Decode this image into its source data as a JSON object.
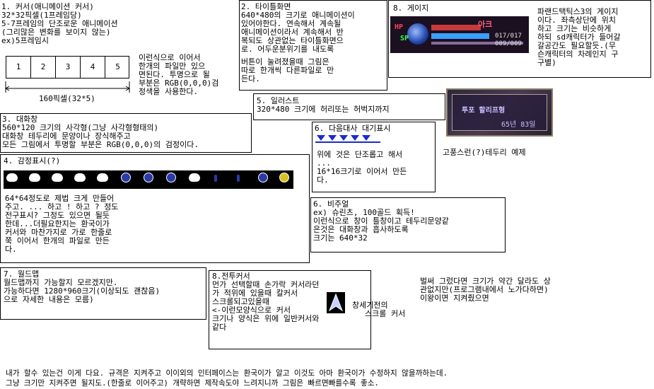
{
  "sec1": {
    "lines": [
      "1. 커서(애니메이션 커서)",
      "32*32픽셀(1프레임당)",
      "5-7프레임의 단조로운 애니메이션",
      "(그리많은 변화를 보이지 않는)",
      "ex)5프레임시"
    ],
    "cells": [
      "1",
      "2",
      "3",
      "4",
      "5"
    ],
    "dim_label": "160픽셀(32*5)",
    "desc": [
      "이런식으로 이어서",
      "한개의 파일만 있으",
      "면된다. 투명으로 될",
      "부분은 RGB(0,0,0)검",
      "정색을 사용한다."
    ]
  },
  "sec2": {
    "lines": [
      "2. 타이틀화면",
      "640*480의 크기로 애니메이션이",
      "있어야한다. 연속해서 계속될",
      "애니메이션이라서 계속해서 반",
      "복되도 상관없는 타이틀화면으",
      "로. 어두운분위기를 내도록",
      "버튼이 눌려졌을때 그림은",
      "따로 한개씩 다른파일로 만",
      "든다."
    ]
  },
  "sec8g": {
    "title": "8. 게이지",
    "gauge": {
      "name": "아크",
      "hp_label": "HP",
      "sp_label": "SP",
      "hp_value": "017/017",
      "sp_value": "009/009"
    },
    "desc": [
      "파랜드택틱스3의 게이지",
      "이다. 좌측상단에 위치",
      "하고 크기는 비슷하게",
      "하되 sd캐릭터가 들어갈",
      "갈공간도 필요할듯.(무",
      "슨캐릭터의 차례인지 구",
      "구별)"
    ]
  },
  "sec5": {
    "lines": [
      "5. 일러스트",
      "320*480 크기에 허리또는 허벅지까지"
    ]
  },
  "frame": {
    "name": "투포 할리프형",
    "stats": "65년 83일",
    "caption": "고풍스런(?)테두리 예제"
  },
  "sec3": {
    "lines": [
      "3. 대화창",
      "560*120 크기의 사각형(그냥 사각형형태의)",
      "대화창 테두리에 문양이나 장식해주고",
      "모든 그림에서 투명할 부분은 RGB(0,0,0)의 검정이다."
    ]
  },
  "sec6a": {
    "lines": [
      "6. 다음대사 대기표시",
      "",
      "위에 것은 단조롭고 해서",
      "...",
      "16*16크기로 이어서 만든",
      "다."
    ]
  },
  "sec4": {
    "title": "4. 감정표시(?)",
    "lines": [
      "64*64정도로 제법 크게 만들어",
      "주고. ... 하고 ! 하고 ? 정도",
      "전구표시? 그정도 있으면 될듯",
      "한데...더필요한지는 환국이가",
      "커서와 마찬가지로 가로 한줄로",
      "쭉 이어서 한개의 파일로 만든",
      "다."
    ]
  },
  "sec6b": {
    "lines": [
      "6. 비주얼",
      "ex) 슈린츠, 100골드 획득!",
      "이런식으로 창이 틀창이고 테두리문양같",
      "은것은 대화창과 흡사하도록",
      "크기는 640*32"
    ]
  },
  "sec7": {
    "lines": [
      "7. 월드맵",
      "월드맵까지 가능할지 모르겠지만.",
      "가능하다면 1280*960크기(이상되도 괜찮음)",
      "으로 자세한 내용은 모름)"
    ]
  },
  "sec8c": {
    "lines": [
      "8.전투커서",
      "먼가 선택할때 손가락 커서라던",
      "가 적위에 있을때 칼커서",
      "스크롤되고있을때",
      "<-이런모양식으로 커서",
      "크기나 양식은 위에 일반커서와",
      "같다"
    ],
    "side_lines": [
      "창세기전의",
      "스크롤 커서"
    ]
  },
  "note": {
    "lines": [
      "벌써 그렀다면 크기가 약간 달라도 상",
      "관없지만(프로그램내에서 노가다하면)",
      "이왕이면 지켜줬으면"
    ]
  },
  "footer": {
    "lines": [
      "내가 할수 있는건 이게 다요. 규격은 지켜주고 이이외의 인터페이스는 환국이가 알고 이것도 아마 환국이가 수정하지 않을까하는데.",
      "그냥 크기만 지켜주면 될지도.(한줄로 이어주고) 개략하면 제작속도야 느려지니까 그림은 빠르면빠를수록 좋소."
    ]
  },
  "colors": {
    "frame_bg": "#3a3040",
    "frame_title": "#c8c0ff",
    "gauge_bg": "#1a1020",
    "gauge_name": "#ff6080",
    "emoji_bar": "#000000",
    "tri_color": "#1a2ad0"
  }
}
